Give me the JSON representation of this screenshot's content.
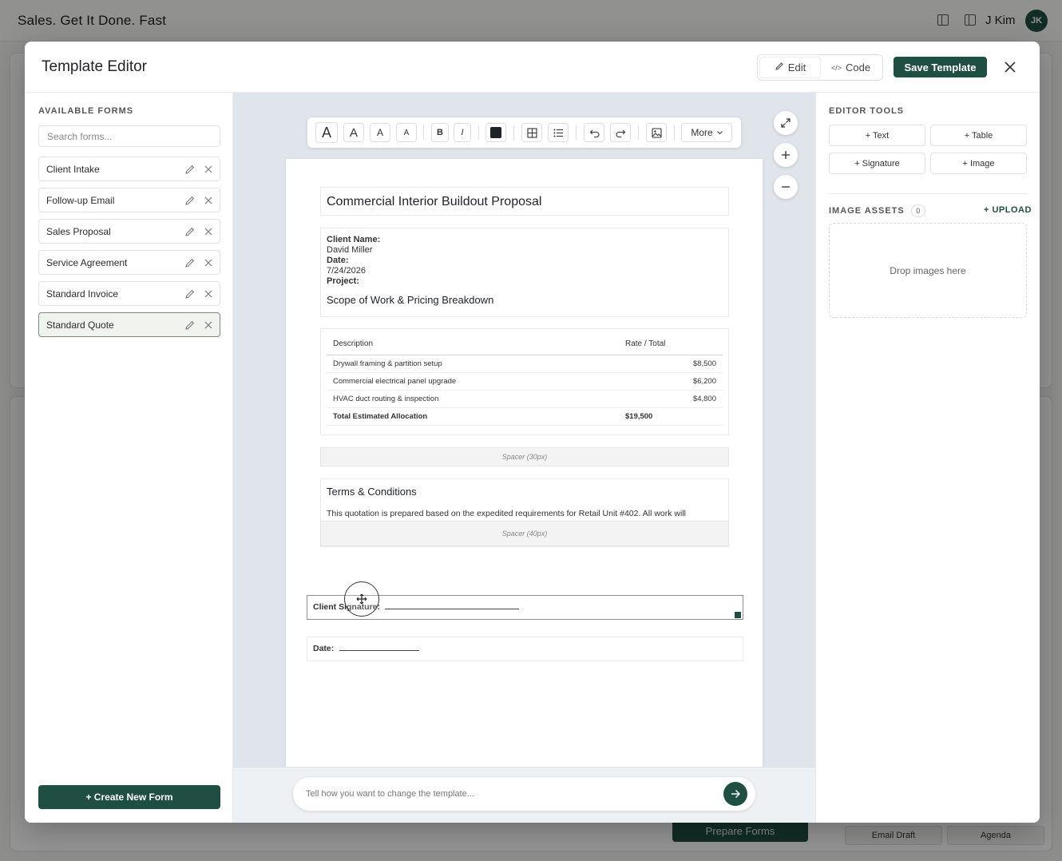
{
  "background": {
    "brand": "Sales. Get It Done. Fast",
    "user_name": "J Kim",
    "user_initials": "JK",
    "prepare_forms_label": "Prepare Forms",
    "email_draft_label": "Email Draft",
    "agenda_label": "Agenda"
  },
  "modal": {
    "title": "Template Editor",
    "edit_label": "Edit",
    "code_label": "Code",
    "save_label": "Save Template"
  },
  "left": {
    "section_label": "AVAILABLE FORMS",
    "search_placeholder": "Search forms...",
    "forms": [
      "Client Intake",
      "Follow-up Email",
      "Sales Proposal",
      "Service Agreement",
      "Standard Invoice",
      "Standard Quote"
    ],
    "selected_form": "Standard Quote",
    "create_label": "+ Create New Form"
  },
  "toolbar": {
    "size_labels": [
      "A",
      "A",
      "A",
      "A"
    ],
    "bold": "B",
    "italic": "I",
    "more_label": "More",
    "text_color": "#1f2328"
  },
  "document": {
    "title": "Commercial Interior Buildout Proposal",
    "client_name_label": "Client Name:",
    "client_name": "David Miller",
    "date_label": "Date:",
    "date": "7/24/2026",
    "project_label": "Project:",
    "project": "Scope of Work & Pricing Breakdown",
    "table": {
      "headers": [
        "Description",
        "Rate / Total"
      ],
      "rows": [
        [
          "Drywall framing & partition setup",
          "$8,500"
        ],
        [
          "Commercial electrical panel upgrade",
          "$6,200"
        ],
        [
          "HVAC duct routing & inspection",
          "$4,800"
        ]
      ],
      "total_label": "Total Estimated Allocation",
      "total_value": "$19,500"
    },
    "spacer1": "Spacer (30px)",
    "terms_title": "Terms & Conditions",
    "terms_text": "This quotation is prepared based on the expedited requirements for Retail Unit #402. All work will",
    "spacer2": "Spacer (40px)",
    "signature_label": "Client Signature:",
    "date_line_label": "Date:"
  },
  "chat": {
    "placeholder": "Tell how you want to change the template..."
  },
  "right": {
    "tools_label": "EDITOR TOOLS",
    "tools": [
      "+ Text",
      "+ Table",
      "+ Signature",
      "+ Image"
    ],
    "assets_label": "IMAGE ASSETS",
    "assets_count": "0",
    "upload_label": "+ UPLOAD",
    "dropzone_text": "Drop images here"
  },
  "colors": {
    "brand_green": "#1f4f43",
    "canvas_bg": "#dfe5ea"
  }
}
